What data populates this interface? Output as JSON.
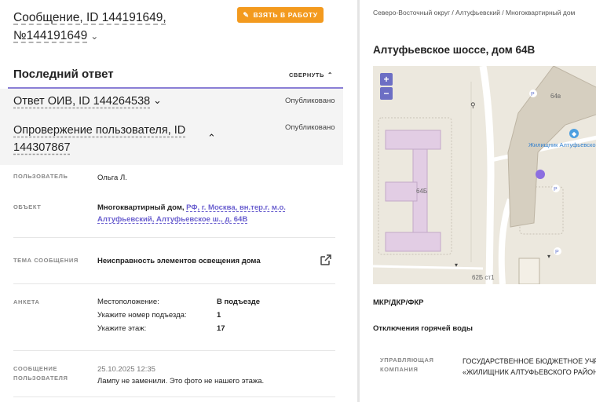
{
  "header": {
    "title": "Сообщение, ID 144191649, №144191649",
    "take_button": "ВЗЯТЬ В РАБОТУ"
  },
  "last_answer": {
    "heading": "Последний ответ",
    "collapse_label": "СВЕРНУТЬ",
    "answer": {
      "title": "Ответ ОИВ, ID 144264538",
      "status": "Опубликовано"
    },
    "refutation": {
      "title": "Опровержение пользователя, ID 144307867",
      "status": "Опубликовано"
    }
  },
  "details": {
    "user_label": "ПОЛЬЗОВАТЕЛЬ",
    "user_value": "Ольга Л.",
    "object_label": "ОБЪЕКТ",
    "object_prefix": "Многоквартирный дом,",
    "object_link": "РФ, г. Москва, вн.тер.г. м.о. Алтуфьевский, Алтуфьевское ш., д. 64В",
    "topic_label": "ТЕМА СООБЩЕНИЯ",
    "topic_value": "Неисправность элементов освещения дома",
    "survey_label": "АНКЕТА",
    "survey": [
      {
        "q": "Местоположение:",
        "a": "В подъезде"
      },
      {
        "q": "Укажите номер подъезда:",
        "a": "1"
      },
      {
        "q": "Укажите этаж:",
        "a": "17"
      }
    ],
    "message_label": "СООБЩЕНИЕ ПОЛЬЗОВАТЕЛЯ",
    "message_date": "25.10.2025 12:35",
    "message_text": "Лампу не заменили. Это фото не нашего этажа."
  },
  "right": {
    "breadcrumb": "Северо-Восточный округ / Алтуфьевский / Многоквартирный дом",
    "address": "Алтуфьевское шоссе, дом 64В",
    "map": {
      "zoom_in": "+",
      "zoom_out": "−",
      "labels": {
        "b64v": "64в",
        "b64b": "64Б",
        "poi": "Жилищник Алтуфьевского района",
        "b62b": "62Б ст1",
        "p1": "P",
        "p2": "P",
        "p3": "P"
      },
      "marker_color": "#8c6ee0"
    },
    "tag": "МКР/ДКР/ФКР",
    "outage": "Отключения горячей воды",
    "manager_label": "УПРАВЛЯЮЩАЯ КОМПАНИЯ",
    "manager_value": "ГОСУДАРСТВЕННОЕ БЮДЖЕТНОЕ УЧРЕЖДЕНИЕ ГОРОДА МОСКВЫ «ЖИЛИЩНИК АЛТУФЬЕВСКОГО РАЙОНА»"
  }
}
